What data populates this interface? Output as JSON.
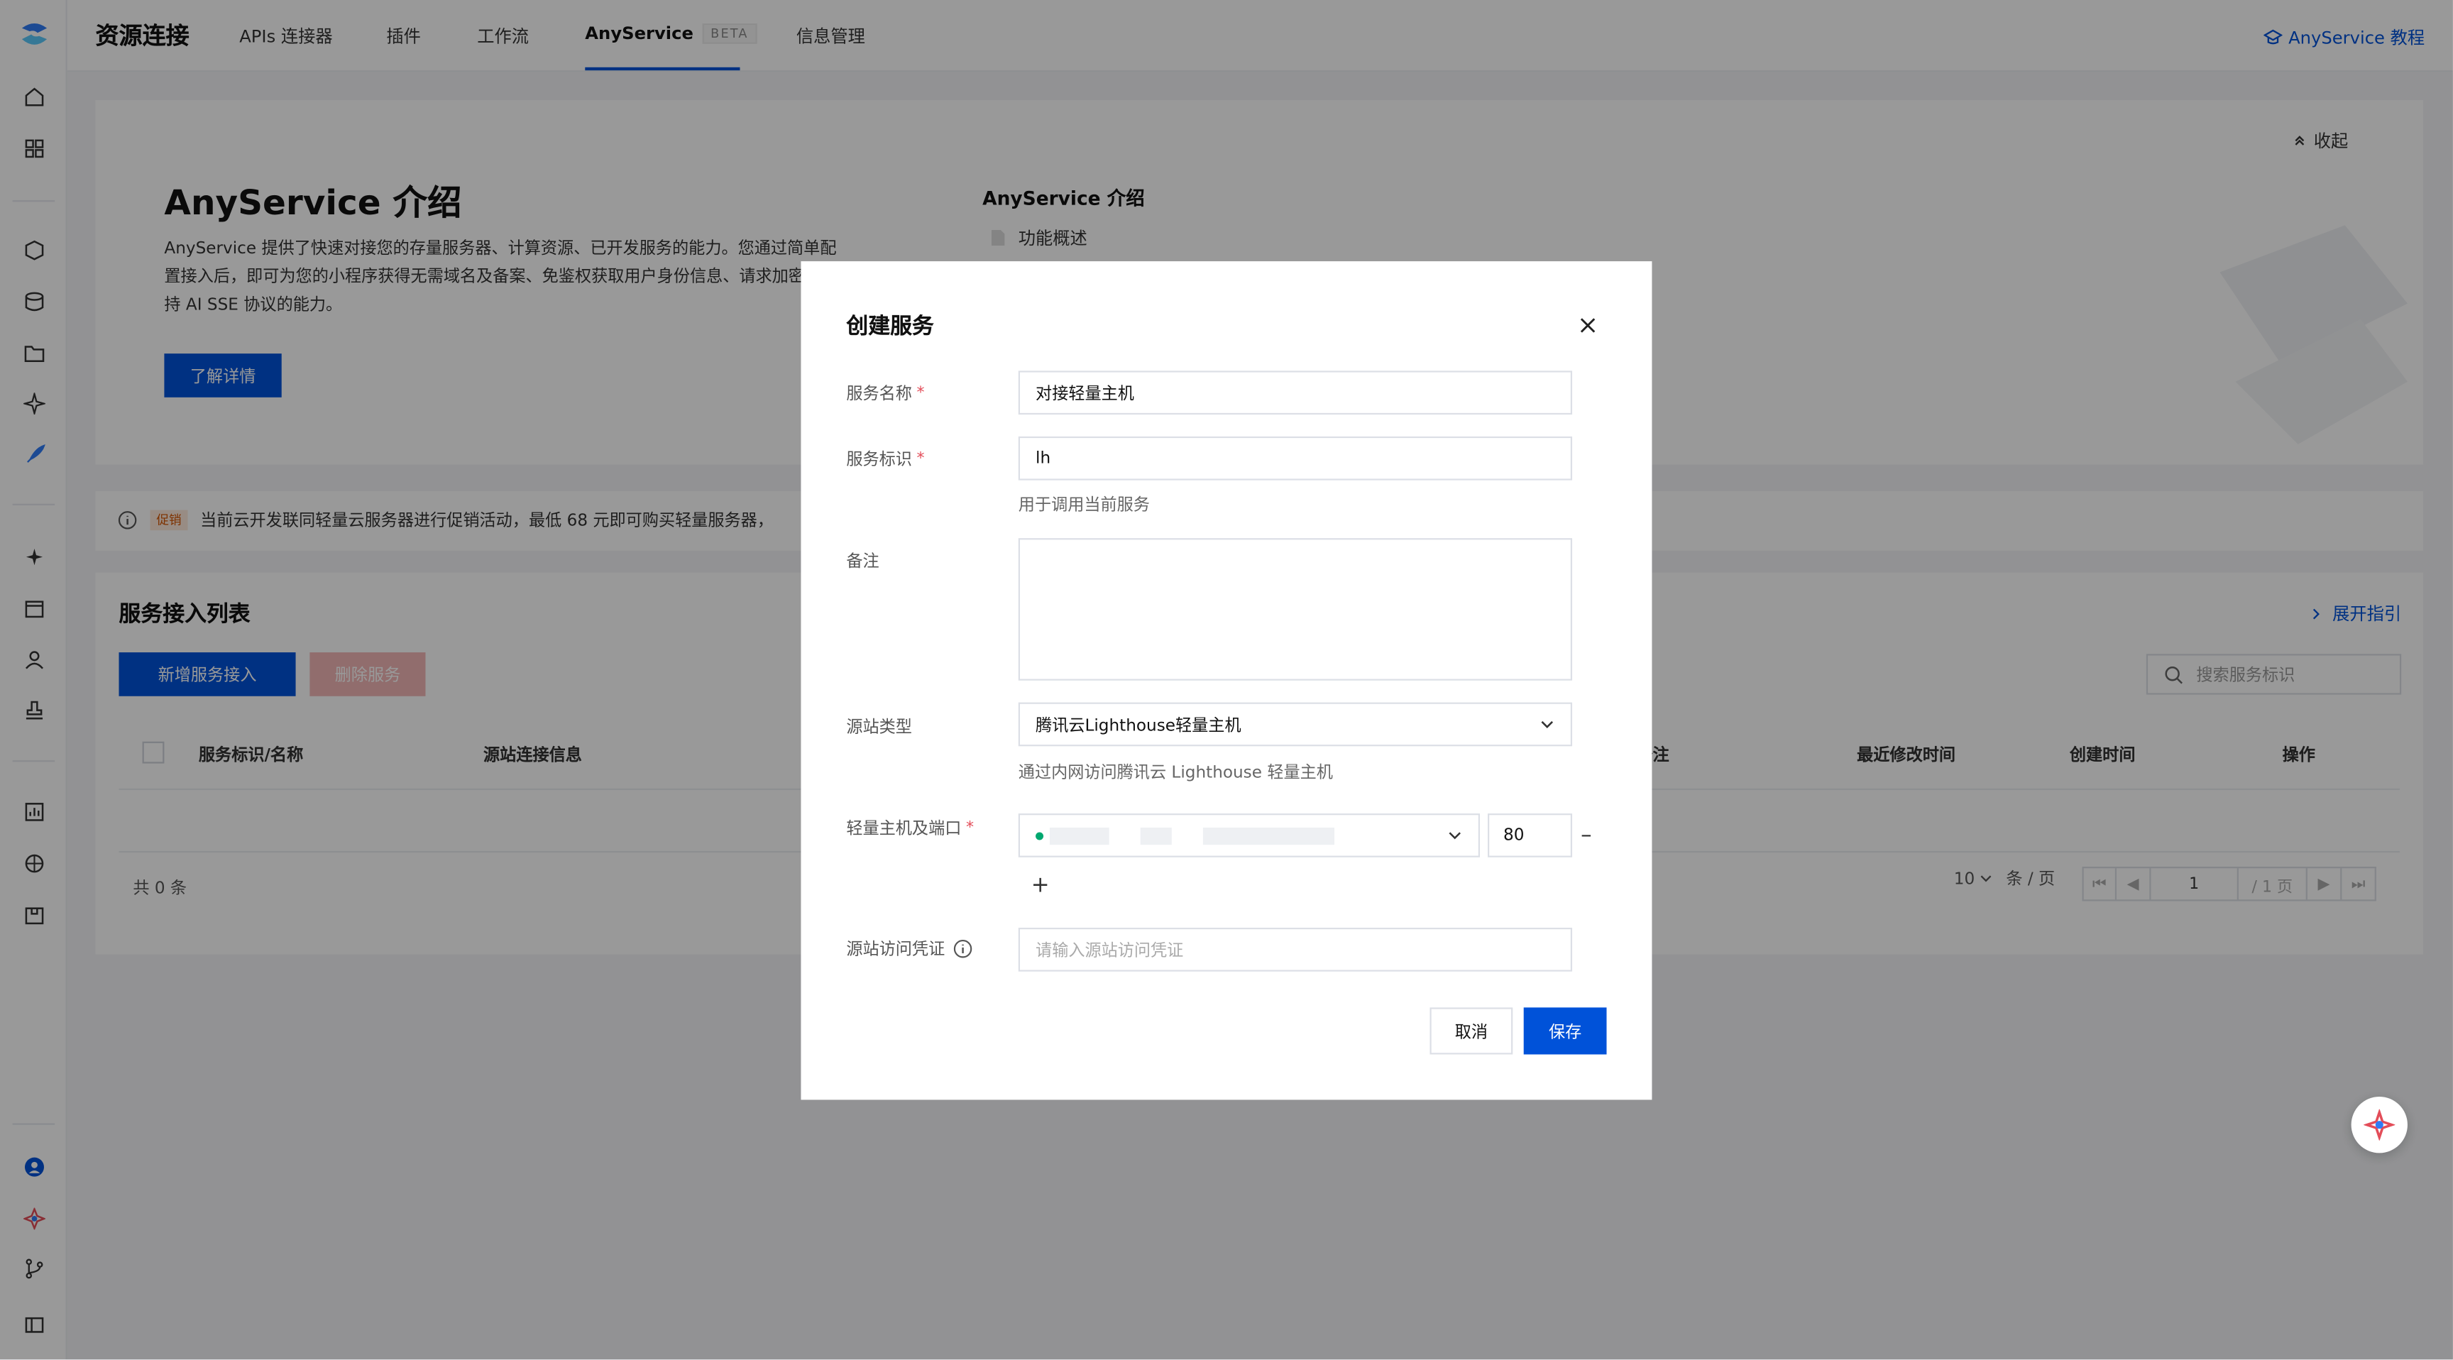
{
  "app": {
    "title": "资源连接",
    "tabs": [
      {
        "label": "APIs 连接器"
      },
      {
        "label": "插件"
      },
      {
        "label": "工作流"
      },
      {
        "label": "AnyService",
        "badge": "BETA",
        "active": true
      },
      {
        "label": "信息管理"
      }
    ],
    "help_link": "AnyService 教程"
  },
  "intro": {
    "title": "AnyService 介绍",
    "description": "AnyService 提供了快速对接您的存量服务器、计算资源、已开发服务的能力。您通过简单配置接入后，即可为您的小程序获得无需域名及备案、免鉴权获取用户身份信息、请求加密、支持 AI SSE 协议的能力。",
    "learn_more": "了解详情",
    "side_title": "AnyService 介绍",
    "side_item": "功能概述",
    "collapse": "收起"
  },
  "promo": {
    "tag": "促销",
    "text": "当前云开发联同轻量云服务器进行促销活动，最低 68 元即可购买轻量服务器，"
  },
  "list": {
    "title": "服务接入列表",
    "add_button": "新增服务接入",
    "delete_button": "删除服务",
    "expand_guide": "展开指引",
    "search_placeholder": "搜索服务标识",
    "columns": [
      "服务标识/名称",
      "源站连接信息",
      "备注",
      "最近修改时间",
      "创建时间",
      "操作"
    ],
    "total": "共 0 条",
    "page_size": "10",
    "page_unit": "条 / 页",
    "page": "1",
    "page_total": "/ 1 页"
  },
  "modal": {
    "title": "创建服务",
    "name_label": "服务名称",
    "name_value": "对接轻量主机",
    "id_label": "服务标识",
    "id_value": "lh",
    "id_help": "用于调用当前服务",
    "remark_label": "备注",
    "origin_type_label": "源站类型",
    "origin_type_value": "腾讯云Lighthouse轻量主机",
    "origin_type_help": "通过内网访问腾讯云 Lighthouse 轻量主机",
    "host_label": "轻量主机及端口",
    "port_value": "80",
    "credential_label": "源站访问凭证",
    "credential_placeholder": "请输入源站访问凭证",
    "cancel": "取消",
    "save": "保存"
  },
  "colors": {
    "primary": "#0052d9",
    "required": "#e34d59",
    "online_dot": "#00a870"
  },
  "icons": {
    "sidebar": [
      "home-icon",
      "dashboard-icon",
      "shield-icon",
      "database-icon",
      "folder-icon",
      "sparkle-icon",
      "rocket-icon",
      "ai-icon",
      "calendar-icon",
      "users-icon",
      "deploy-icon",
      "chart-icon",
      "cube-icon",
      "package-icon",
      "user-icon",
      "logo-icon",
      "git-branch-icon",
      "panel-icon"
    ]
  }
}
